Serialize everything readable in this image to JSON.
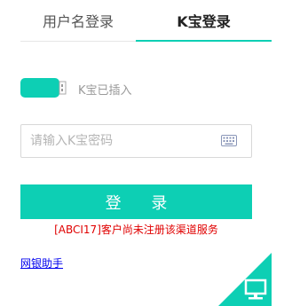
{
  "tabs": {
    "username_login": "用户名登录",
    "kbao_login": "K宝登录"
  },
  "kbao": {
    "status_text": "K宝已插入",
    "icon": "usb-key-icon"
  },
  "password": {
    "value": "",
    "placeholder": "请输入K宝密码",
    "keyboard_icon": "keyboard-icon"
  },
  "login_button": "登 录",
  "error_message": "[ABCI17]客户尚未注册该渠道服务",
  "help_link": "网银助手",
  "corner_icon": "computer-monitor-icon",
  "colors": {
    "accent": "#0dcfb4",
    "error": "#e00000",
    "link": "#0000ee"
  }
}
